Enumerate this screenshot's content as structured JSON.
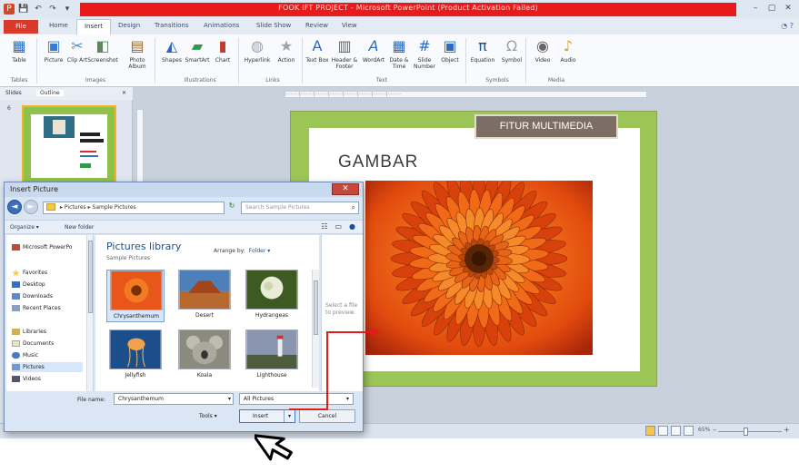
{
  "window": {
    "title": "FOOK IFT PROJECT - Microsoft PowerPoint (Product Activation Failed)",
    "quick_access": [
      "P",
      "💾",
      "↶",
      "↷",
      "▾"
    ],
    "controls": [
      "–",
      "▢",
      "✕"
    ]
  },
  "tabs": {
    "file": "File",
    "items": [
      "Home",
      "Insert",
      "Design",
      "Transitions",
      "Animations",
      "Slide Show",
      "Review",
      "View"
    ],
    "help": "◔ ?"
  },
  "ribbon": {
    "buttons": [
      {
        "label": "Table",
        "icon": "table-icon"
      },
      {
        "label": "Picture",
        "icon": "picture-icon"
      },
      {
        "label": "Clip Art",
        "icon": "clip-art-icon"
      },
      {
        "label": "Screenshot",
        "icon": "screenshot-icon"
      },
      {
        "label": "Photo Album",
        "icon": "photo-album-icon"
      },
      {
        "label": "Shapes",
        "icon": "shapes-icon"
      },
      {
        "label": "SmartArt",
        "icon": "smartart-icon"
      },
      {
        "label": "Chart",
        "icon": "chart-icon"
      },
      {
        "label": "Hyperlink",
        "icon": "hyperlink-icon"
      },
      {
        "label": "Action",
        "icon": "action-icon"
      },
      {
        "label": "Text Box",
        "icon": "text-box-icon"
      },
      {
        "label": "Header & Footer",
        "icon": "header-footer-icon"
      },
      {
        "label": "WordArt",
        "icon": "wordart-icon"
      },
      {
        "label": "Date & Time",
        "icon": "date-time-icon"
      },
      {
        "label": "Slide Number",
        "icon": "slide-number-icon"
      },
      {
        "label": "Object",
        "icon": "object-icon"
      },
      {
        "label": "Equation",
        "icon": "equation-icon"
      },
      {
        "label": "Symbol",
        "icon": "symbol-icon"
      },
      {
        "label": "Video",
        "icon": "video-icon"
      },
      {
        "label": "Audio",
        "icon": "audio-icon"
      }
    ],
    "groups": [
      "Tables",
      "Images",
      "Illustrations",
      "Links",
      "Text",
      "Symbols",
      "Media"
    ]
  },
  "pane": {
    "tabs": [
      "Slides",
      "Outline"
    ],
    "close": "✕",
    "slide_number": "6"
  },
  "slide": {
    "title_box": "FITUR MULTIMEDIA",
    "heading": "GAMBAR"
  },
  "dialog": {
    "title": "Insert Picture",
    "close": "✕",
    "address": "▸ Pictures ▸ Sample Pictures",
    "search_placeholder": "Search Sample Pictures",
    "organize": "Organize ▾",
    "new_folder": "New folder",
    "nav_items": [
      {
        "label": "Microsoft PowerPo",
        "icon": "powerpoint-icon"
      },
      {
        "label": "Favorites",
        "icon": "favorites-icon"
      },
      {
        "label": "Desktop",
        "icon": "desktop-icon"
      },
      {
        "label": "Downloads",
        "icon": "downloads-icon"
      },
      {
        "label": "Recent Places",
        "icon": "recent-places-icon"
      },
      {
        "label": "Libraries",
        "icon": "libraries-icon"
      },
      {
        "label": "Documents",
        "icon": "documents-icon"
      },
      {
        "label": "Music",
        "icon": "music-icon"
      },
      {
        "label": "Pictures",
        "icon": "pictures-icon"
      },
      {
        "label": "Videos",
        "icon": "videos-icon"
      }
    ],
    "library_title": "Pictures library",
    "library_sub": "Sample Pictures",
    "arrange_label": "Arrange by:",
    "arrange_value": "Folder ▾",
    "files": [
      "Chrysanthemum",
      "Desert",
      "Hydrangeas",
      "Jellyfish",
      "Koala",
      "Lighthouse"
    ],
    "selected_file": "Chrysanthemum",
    "preview_msg": "Select a file to preview.",
    "file_name_label": "File name:",
    "file_name_value": "Chrysanthemum",
    "file_type": "All Pictures",
    "tools": "Tools ▾",
    "insert": "Insert",
    "cancel": "Cancel"
  },
  "status": {
    "zoom": "65%",
    "zoom_minus": "–",
    "zoom_plus": "+"
  }
}
